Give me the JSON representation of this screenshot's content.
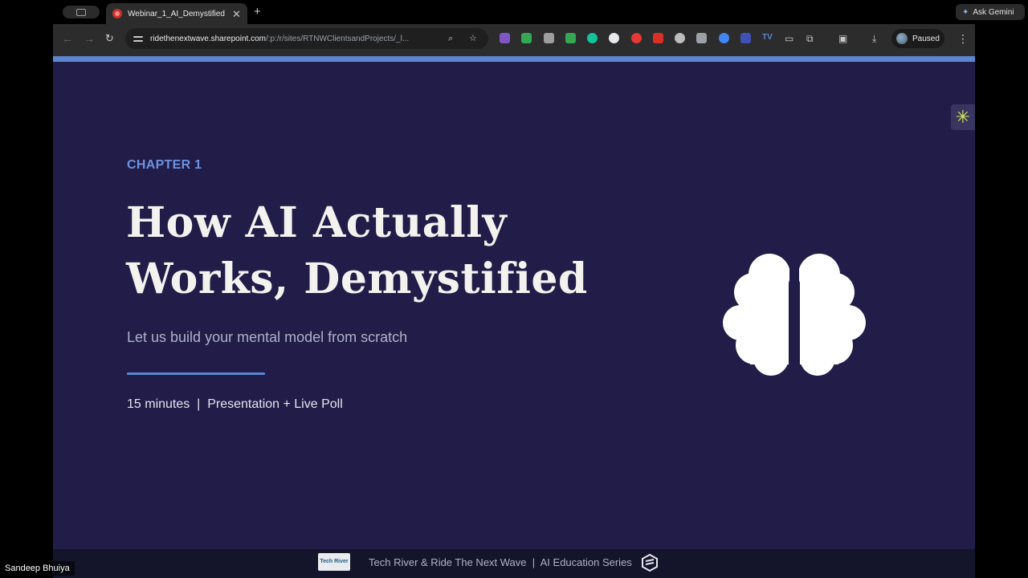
{
  "browser": {
    "tab": {
      "title": "Webinar_1_AI_Demystified - "
    },
    "new_tab_symbol": "+",
    "ask_gemini_label": "Ask Gemini",
    "omnibox": {
      "url_host": "ridethenextwave.sharepoint.com",
      "url_path": "/:p:/r/sites/RTNWClientsandProjects/_l..."
    },
    "extensions": [
      {
        "name": "puzzle-ext",
        "color": "#7e57c2"
      },
      {
        "name": "green-ext",
        "color": "#34a853"
      },
      {
        "name": "grey-ext",
        "color": "#9e9e9e"
      },
      {
        "name": "green-ext-2",
        "color": "#34a853"
      },
      {
        "name": "grammarly-ext",
        "color": "#15c39a"
      },
      {
        "name": "s-ext",
        "color": "#e8eaed"
      },
      {
        "name": "red-ext",
        "color": "#e53935"
      },
      {
        "name": "red-ext-2",
        "color": "#d93025"
      },
      {
        "name": "round-ext",
        "color": "#bdbdbd"
      },
      {
        "name": "grid-ext",
        "color": "#9aa0a6"
      },
      {
        "name": "blue-ext",
        "color": "#4285f4"
      },
      {
        "name": "pen-ext",
        "color": "#3f51b5"
      }
    ],
    "tv_ext_label": "TV",
    "profile_label": "Paused"
  },
  "slide": {
    "chapter": "CHAPTER 1",
    "headline_line1": "How AI Actually",
    "headline_line2": "Works, Demystified",
    "subtitle": "Let us build your mental model from scratch",
    "meta": "15 minutes  |  Presentation + Live Poll",
    "accent_color": "#5b86d2",
    "background_color": "#211c48"
  },
  "footer": {
    "logo_text": "Tech River",
    "text": "Tech River & Ride The Next Wave  |  AI Education Series"
  },
  "meeting": {
    "speaker_name": "Sandeep Bhuiya"
  }
}
